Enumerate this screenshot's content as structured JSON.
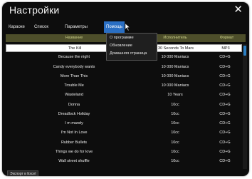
{
  "window": {
    "title": "Настройки",
    "close_glyph": "✕"
  },
  "menu": {
    "items": [
      "Караоке",
      "Список",
      "Параметры",
      "Помощь"
    ],
    "active": "Помощь"
  },
  "dropdown": {
    "items": [
      "О программе",
      "Обновление",
      "Домашняя страница"
    ]
  },
  "table": {
    "columns": [
      "Название",
      "Исполнитель",
      "Формат"
    ],
    "selected_index": 0,
    "rows": [
      [
        "The Kill",
        "30 Seconds To Mars",
        "MP3"
      ],
      [
        "Because the night",
        "10 000 Maniacs",
        "CD+G"
      ],
      [
        "Candy everybody wants",
        "10 000 Maniacs",
        "CD+G"
      ],
      [
        "More Than This",
        "10 000 Maniacs",
        "CD+G"
      ],
      [
        "Trouble Me",
        "10 000 Maniacs",
        "CD+G"
      ],
      [
        "Wasteland",
        "10 Years",
        "CD+G"
      ],
      [
        "Donna",
        "10cc",
        "CD+G"
      ],
      [
        "Dreadlock Holiday",
        "10cc",
        "CD+G"
      ],
      [
        "I m mandy",
        "10cc",
        "CD+G"
      ],
      [
        "I'm Not In Love",
        "10cc",
        "CD+G"
      ],
      [
        "Rubber Bullets",
        "10cc",
        "CD+G"
      ],
      [
        "Things we do for love",
        "10cc",
        "CD+G"
      ],
      [
        "Wall street shuffle",
        "10cc",
        "CD+G"
      ]
    ]
  },
  "footer": {
    "export_label": "Экспорт в Excel"
  },
  "colors": {
    "window_bg": "#0d0d0d",
    "header_bg": "#4d4e2a",
    "header_text": "#cdd28a",
    "menu_active_bg": "#2a6fc4",
    "scroll_thumb": "#2a7fc4",
    "selected_row_bg": "#ffffff"
  },
  "icons": {
    "close": "close-icon",
    "cursor": "cursor-pointer-icon"
  }
}
